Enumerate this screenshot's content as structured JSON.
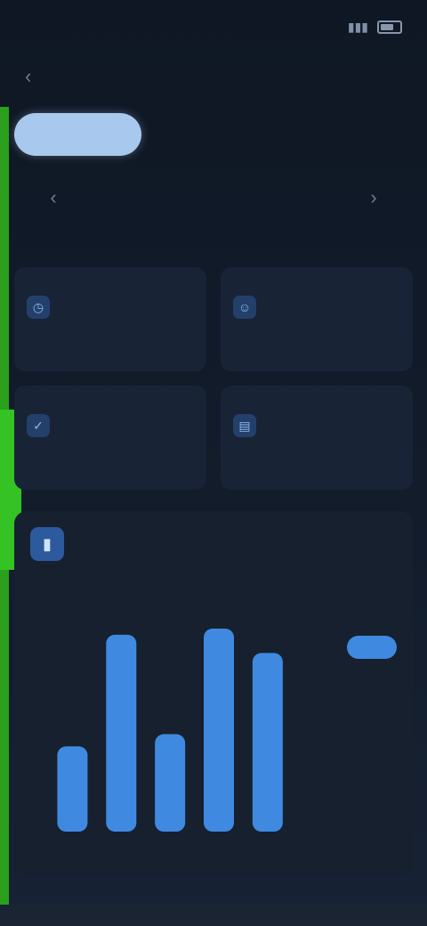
{
  "status": {
    "time": "",
    "signal_icon": "signal-icon",
    "battery_icon": "battery-icon"
  },
  "nav": {
    "title": "",
    "back_icon": "chevron-left-icon"
  },
  "segments": [
    {
      "label": "",
      "active": true
    },
    {
      "label": "",
      "active": false
    },
    {
      "label": "",
      "active": false
    }
  ],
  "period": {
    "range": "",
    "prev_icon": "chevron-left-icon",
    "next_icon": "chevron-right-icon"
  },
  "stats": [
    {
      "label": "",
      "value": "",
      "delta": "",
      "sub": "",
      "trend": "down",
      "icon": "clock-icon",
      "color": "#3b6bb5"
    },
    {
      "label": "",
      "value": "",
      "delta": "",
      "sub": "",
      "trend": "up",
      "icon": "user-icon",
      "color": "#3b6bb5"
    },
    {
      "label": "",
      "value": "",
      "delta": "",
      "sub": "",
      "trend": "down",
      "icon": "check-icon",
      "color": "#3b6bb5"
    },
    {
      "label": "",
      "value": "",
      "delta": "",
      "sub": "",
      "trend": "up",
      "icon": "chart-icon",
      "color": "#3b6bb5"
    }
  ],
  "panel": {
    "title": "",
    "subtitle": "",
    "total": "",
    "delta": "",
    "icon": "bar-chart-icon"
  },
  "colors": {
    "accent": "#3f8ae0",
    "highlight": "#3f8ae0",
    "positive": "#3fa35c",
    "negative": "#c85252",
    "sidebar_accent": "#34c224"
  },
  "chart_data": {
    "type": "bar",
    "categories": [
      "",
      "",
      "",
      "",
      "",
      "",
      ""
    ],
    "values": [
      0.42,
      0.97,
      0.48,
      1.0,
      0.88,
      0,
      0
    ],
    "highlight_index": null,
    "ylim": [
      0,
      1
    ],
    "grid": false
  }
}
